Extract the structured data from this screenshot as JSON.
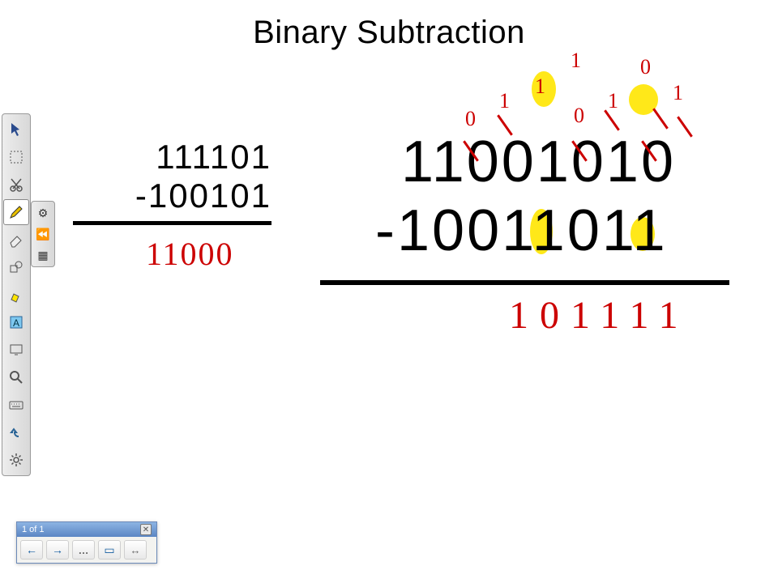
{
  "title": "Binary Subtraction",
  "problem1": {
    "minuend": "111101",
    "subtrahend": "-100101",
    "result": "11000"
  },
  "problem2": {
    "minuend": "11001010",
    "subtrahend": "-10011011",
    "result": "101111",
    "borrow_annotations": [
      "0",
      "1",
      "1",
      "1",
      "0",
      "1",
      "0",
      "1"
    ]
  },
  "toolbar": {
    "tools": [
      {
        "name": "pointer-icon"
      },
      {
        "name": "select-icon"
      },
      {
        "name": "cut-icon"
      },
      {
        "name": "pen-icon",
        "selected": true
      },
      {
        "name": "eraser-icon"
      },
      {
        "name": "shapes-icon"
      },
      {
        "name": "highlighter-icon"
      },
      {
        "name": "text-icon"
      },
      {
        "name": "screen-icon"
      },
      {
        "name": "zoom-icon"
      },
      {
        "name": "keyboard-icon"
      },
      {
        "name": "undo-icon"
      },
      {
        "name": "settings-icon"
      }
    ],
    "subpanel": [
      {
        "name": "gear-icon"
      },
      {
        "name": "rewind-icon"
      },
      {
        "name": "calc-icon"
      }
    ]
  },
  "pager": {
    "label": "1 of 1",
    "buttons": {
      "prev": "←",
      "next": "→",
      "more": "…",
      "present": "▭",
      "fit": "↔"
    }
  }
}
